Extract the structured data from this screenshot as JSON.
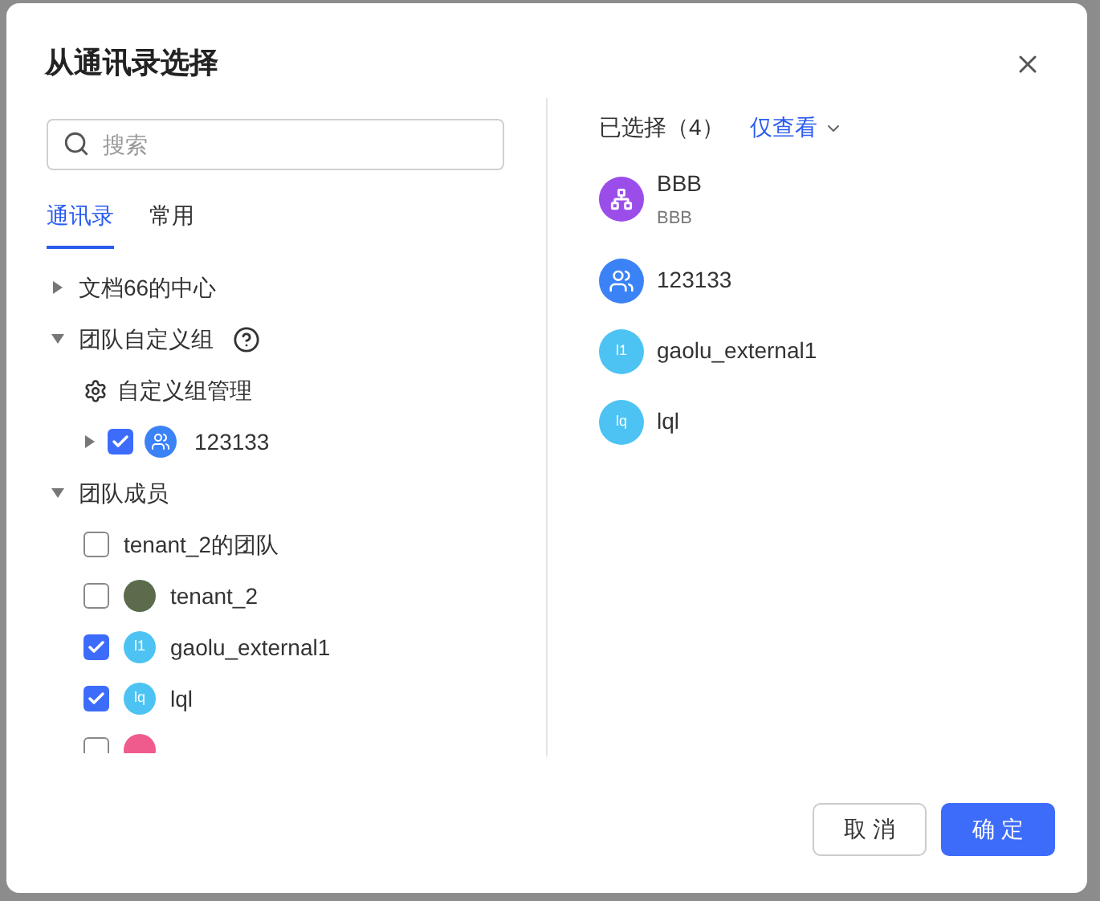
{
  "dialog": {
    "title": "从通讯录选择"
  },
  "search": {
    "placeholder": "搜索"
  },
  "tabs": [
    {
      "label": "通讯录",
      "selected": true
    },
    {
      "label": "常用",
      "selected": false
    }
  ],
  "tree": [
    {
      "label": "文档66的中心",
      "expanded": false,
      "help": false
    },
    {
      "label": "团队自定义组",
      "expanded": true,
      "help": true,
      "children": [
        {
          "kind": "action",
          "label": "自定义组管理"
        },
        {
          "kind": "group",
          "label": "123133",
          "checked": true,
          "expanded": false,
          "color": "#3b82f6"
        }
      ]
    },
    {
      "label": "团队成员",
      "expanded": true,
      "help": false,
      "children": [
        {
          "kind": "team",
          "label": "tenant_2的团队",
          "checked": false
        },
        {
          "kind": "photo",
          "label": "tenant_2",
          "checked": false
        },
        {
          "kind": "user",
          "label": "gaolu_external1",
          "initials": "l1",
          "checked": true,
          "color": "#4cc3f3"
        },
        {
          "kind": "user",
          "label": "lql",
          "initials": "lq",
          "checked": true,
          "color": "#4cc3f3"
        },
        {
          "kind": "user",
          "checked": false,
          "color": "#ef5b8d"
        }
      ]
    }
  ],
  "selected_header": {
    "label": "已选择（4）",
    "filter": "仅查看"
  },
  "selected_items": [
    {
      "kind": "org",
      "name": "BBB",
      "subtitle": "BBB",
      "color": "#9b4dea"
    },
    {
      "kind": "group",
      "name": "123133",
      "color": "#3b82f6"
    },
    {
      "kind": "user",
      "name": "gaolu_external1",
      "initials": "l1",
      "color": "#4cc3f3"
    },
    {
      "kind": "user",
      "name": "lql",
      "initials": "lq",
      "color": "#4cc3f3"
    }
  ],
  "buttons": [
    {
      "label": "取 消",
      "primary": false
    },
    {
      "label": "确 定",
      "primary": true
    }
  ]
}
